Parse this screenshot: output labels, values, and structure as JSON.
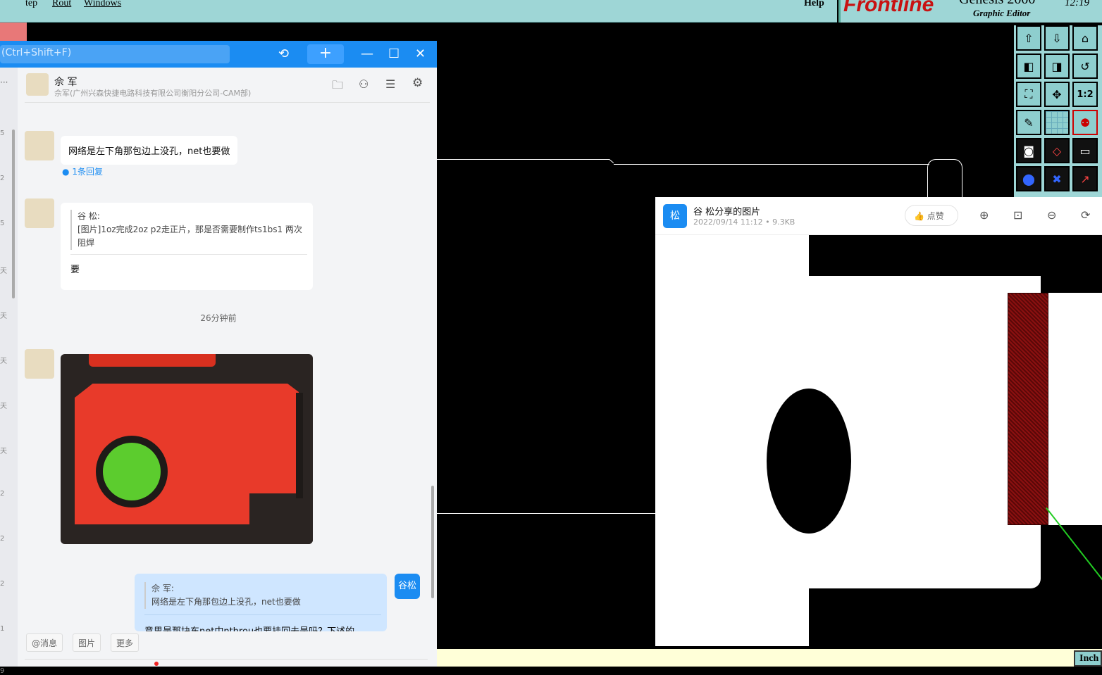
{
  "genesis": {
    "menu": [
      "Step",
      "Rout",
      "Windows"
    ],
    "menu_visible": [
      "tep",
      "Rout",
      "Windows"
    ],
    "help": "Help",
    "brand": "Frontline",
    "product": "Genesis 2000",
    "subtitle": "Graphic Editor",
    "clock": "12:19",
    "status_unit": "Inch",
    "palette_labels": [
      "1:2"
    ]
  },
  "chat": {
    "search_placeholder": "(Ctrl+Shift+F)",
    "contact_name": "佘 军",
    "contact_org": "佘军(广州兴森快捷电路科技有限公司衡阳分公司-CAM部)",
    "left_rail_digits": [
      "5",
      "2",
      "5",
      "天",
      "天",
      "天",
      "天",
      "天",
      "2",
      "2",
      "2",
      "1",
      "9"
    ],
    "messages": [
      {
        "text": "网络是左下角那包边上没孔，net也要做",
        "reply_count": "1条回复"
      },
      {
        "quote_author": "谷 松:",
        "quote_text": "[图片]1oz完成2oz p2走正片，那是否需要制作ts1bs1 两次阻焊",
        "text": "要"
      }
    ],
    "time_divider": "26分钟前",
    "my_message": {
      "quote_author": "佘 军:",
      "quote_text": "网络是左下角那包边上没孔，net也要做",
      "text_partial": "意思是那块东net中nthrou也要挂回去是吗？下述的"
    },
    "self_avatar": "谷松",
    "footer_buttons": [
      "@消息",
      "图片",
      "更多"
    ]
  },
  "viewer": {
    "avatar": "松",
    "title": "谷 松分享的图片",
    "meta": "2022/09/14 11:12 • 9.3KB",
    "like": "点赞"
  },
  "colors": {
    "genesis_bg": "#9ed6d6",
    "chat_blue": "#1b8cf2",
    "pcb_red": "#e83a2a",
    "pad_green": "#5ccc2e"
  }
}
